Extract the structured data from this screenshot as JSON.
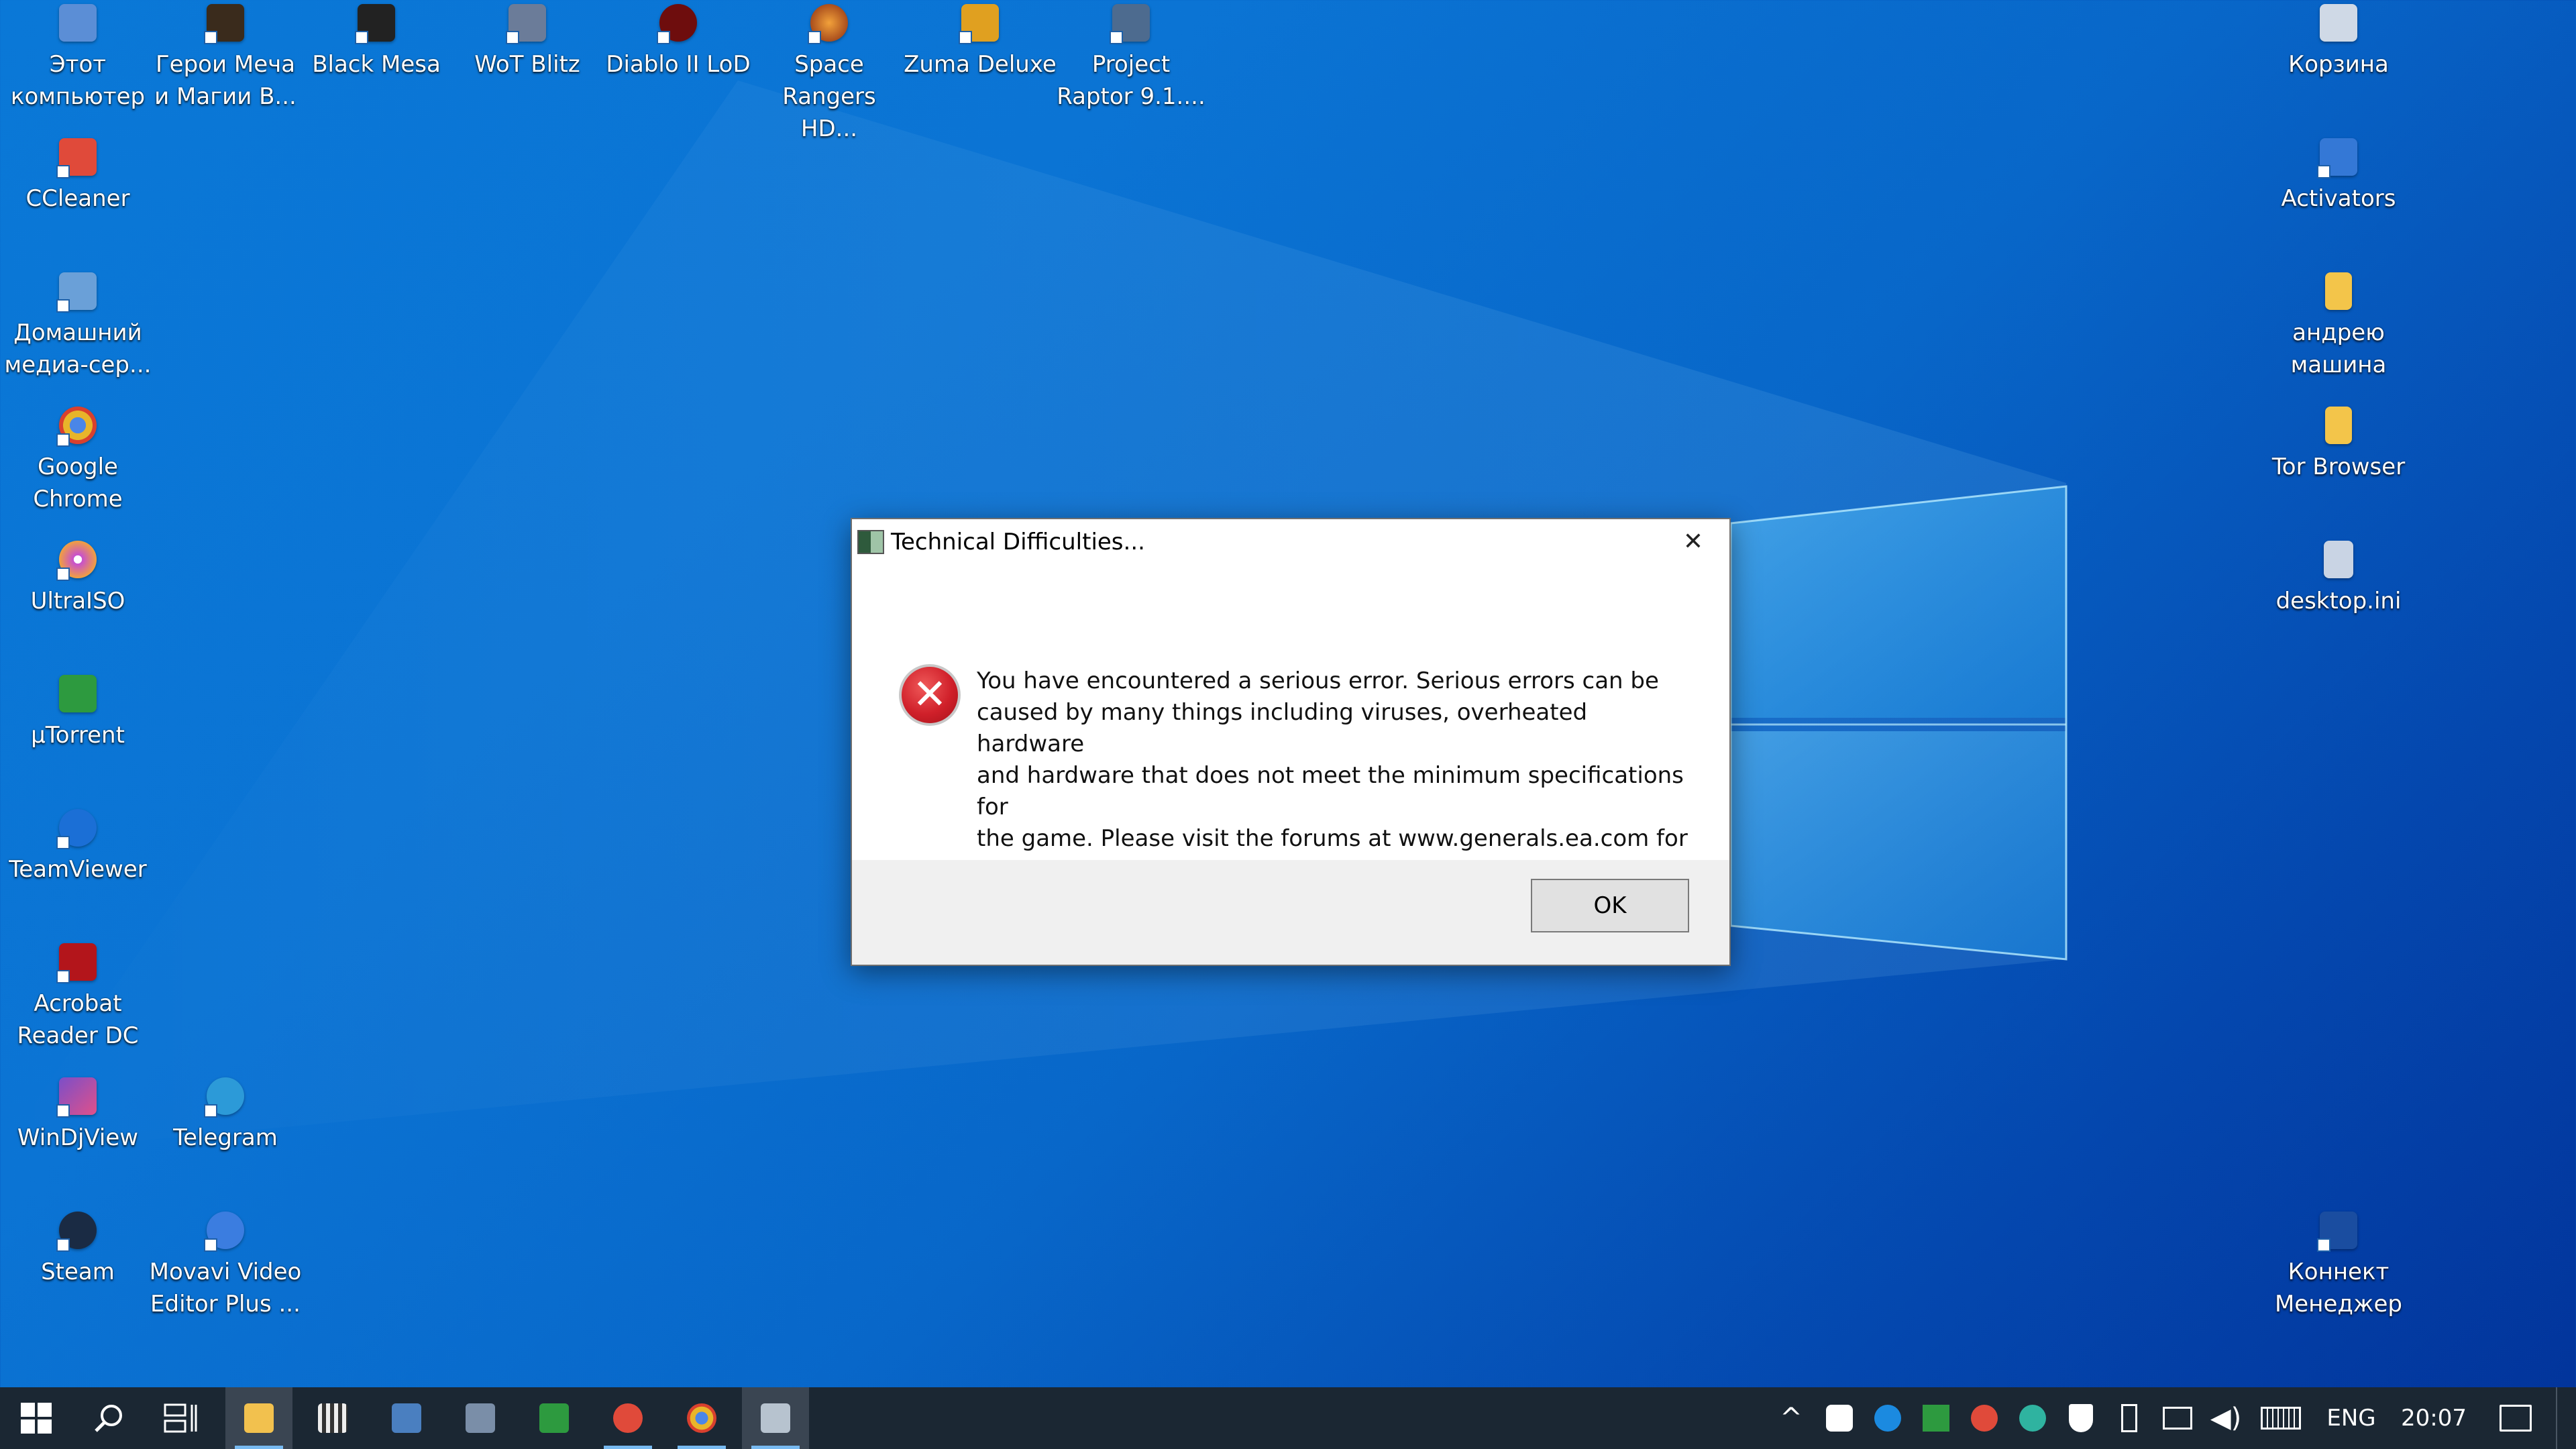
{
  "desktop": {
    "left_icons": [
      {
        "label": "Этот\nкомпьютер",
        "color": "#5b8ed6"
      },
      {
        "label": "CCleaner",
        "color": "#e04a3a"
      },
      {
        "label": "Домашний\nмедиа-сер...",
        "color": "#6aa0d8"
      },
      {
        "label": "Google\nChrome",
        "color": "#e8b52a"
      },
      {
        "label": "UltraISO",
        "color": "#c74fd0"
      },
      {
        "label": "µTorrent",
        "color": "#2d9a3f"
      },
      {
        "label": "TeamViewer",
        "color": "#1b6fd6"
      },
      {
        "label": "Acrobat\nReader DC",
        "color": "#b3151b"
      },
      {
        "label": "WinDjView",
        "color": "#7a4fc9"
      },
      {
        "label": "Steam",
        "color": "#1a2b44"
      }
    ],
    "top_icons": [
      {
        "label": "Герои Меча\nи Магии В...",
        "color": "#3a2b1c"
      },
      {
        "label": "Black Mesa",
        "color": "#222222"
      },
      {
        "label": "WoT Blitz",
        "color": "#6b7c99"
      },
      {
        "label": "Diablo II LoD",
        "color": "#6e0d0d"
      },
      {
        "label": "Space\nRangers HD...",
        "color": "#c05a1a"
      },
      {
        "label": "Zuma Deluxe",
        "color": "#e0a020"
      },
      {
        "label": "Project\nRaptor 9.1....",
        "color": "#4d6b8f"
      }
    ],
    "second_col_icons": [
      {
        "label": "Telegram",
        "color": "#2c9ad8"
      },
      {
        "label": "Movavi Video\nEditor Plus ...",
        "color": "#3b7de0"
      }
    ],
    "right_icons": [
      {
        "label": "Корзина",
        "color": "#cfd9e6"
      },
      {
        "label": "Activators",
        "color": "#3478d6"
      },
      {
        "label": "андрею\nмашина",
        "color": "#f3c54a"
      },
      {
        "label": "Tor Browser",
        "color": "#f3c54a"
      },
      {
        "label": "desktop.ini",
        "color": "#c9d4e4"
      },
      {
        "label": "Коннект\nМенеджер",
        "color": "#1a4da0"
      }
    ]
  },
  "dialog": {
    "title": "Technical Difficulties...",
    "close_symbol": "✕",
    "error_symbol": "✕",
    "message": "You have encountered a serious error.  Serious errors can be\ncaused by many things including viruses, overheated hardware\nand hardware that does not meet the minimum specifications for\nthe game. Please visit the forums at www.generals.ea.com for\nsuggested courses of action or consult your manual for Technical\nSupport contact information.",
    "ok_label": "OK"
  },
  "taskbar": {
    "pinned": [
      {
        "name": "file-explorer",
        "color": "#f2c14e",
        "active": true
      },
      {
        "name": "media-player",
        "color": "#555555",
        "active": false
      },
      {
        "name": "app-paint",
        "color": "#4a7fc0",
        "active": false
      },
      {
        "name": "app-monitor",
        "color": "#7a8ea8",
        "active": false
      },
      {
        "name": "utorrent",
        "color": "#2d9a3f",
        "active": false
      },
      {
        "name": "ccleaner",
        "color": "#e04a3a",
        "active": true
      },
      {
        "name": "chrome",
        "color": "#e8b52a",
        "active": true
      },
      {
        "name": "game-generals",
        "color": "#b7c3cf",
        "active": true
      }
    ],
    "language": "ENG",
    "time": "20:07"
  }
}
